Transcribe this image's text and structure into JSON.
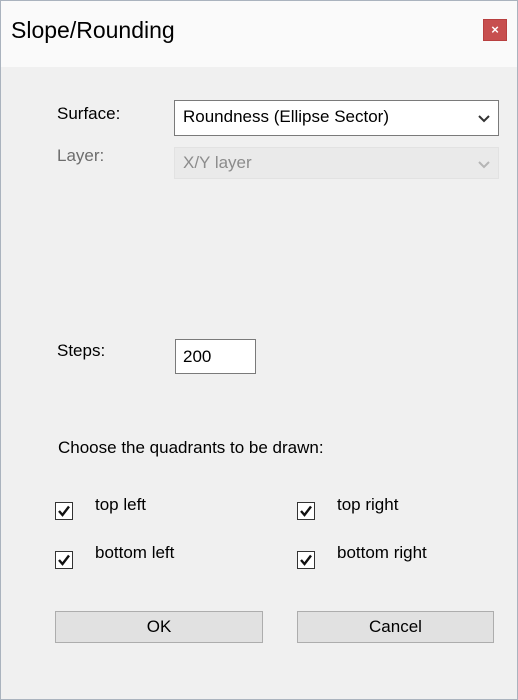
{
  "window": {
    "title": "Slope/Rounding",
    "close_glyph": "×"
  },
  "surface": {
    "label": "Surface:",
    "value": "Roundness (Ellipse Sector)"
  },
  "layer": {
    "label": "Layer:",
    "value": "X/Y layer",
    "enabled": false
  },
  "steps": {
    "label": "Steps:",
    "value": "200"
  },
  "quadrants": {
    "heading": "Choose the quadrants to be drawn:",
    "items": [
      {
        "label": "top left",
        "checked": true
      },
      {
        "label": "top right",
        "checked": true
      },
      {
        "label": "bottom left",
        "checked": true
      },
      {
        "label": "bottom right",
        "checked": true
      }
    ]
  },
  "buttons": {
    "ok": "OK",
    "cancel": "Cancel"
  },
  "colors": {
    "close_button": "#c74f4f",
    "dialog_background": "#f0f0f0",
    "titlebar_background": "#fafafa"
  },
  "icons": {
    "close": "close-icon",
    "dropdown": "chevron-down-icon",
    "checkbox": "checkmark-icon"
  }
}
